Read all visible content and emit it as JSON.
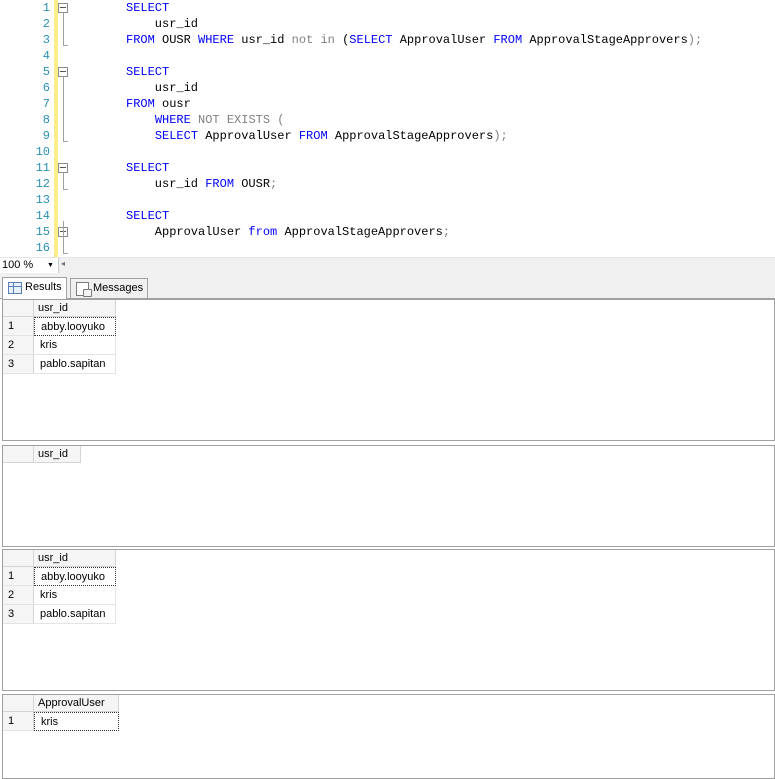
{
  "editor": {
    "lines": [
      {
        "n": "1",
        "tokens": [
          [
            "kw",
            "SELECT"
          ]
        ]
      },
      {
        "n": "2",
        "tokens": [
          [
            "tx",
            "    usr_id"
          ]
        ]
      },
      {
        "n": "3",
        "tokens": [
          [
            "kw",
            "FROM "
          ],
          [
            "tx",
            "OUSR "
          ],
          [
            "kw",
            "WHERE "
          ],
          [
            "tx",
            "usr_id "
          ],
          [
            "gr",
            "not in "
          ],
          [
            "tx",
            "("
          ],
          [
            "kw",
            "SELECT "
          ],
          [
            "tx",
            "ApprovalUser "
          ],
          [
            "kw",
            "FROM "
          ],
          [
            "tx",
            "ApprovalStageApprovers"
          ],
          [
            "gr",
            ");"
          ]
        ]
      },
      {
        "n": "4",
        "tokens": []
      },
      {
        "n": "5",
        "tokens": [
          [
            "kw",
            "SELECT"
          ]
        ]
      },
      {
        "n": "6",
        "tokens": [
          [
            "tx",
            "    usr_id"
          ]
        ]
      },
      {
        "n": "7",
        "tokens": [
          [
            "kw",
            "FROM "
          ],
          [
            "tx",
            "ousr"
          ]
        ]
      },
      {
        "n": "8",
        "tokens": [
          [
            "tx",
            "    "
          ],
          [
            "kw",
            "WHERE "
          ],
          [
            "gr",
            "NOT EXISTS ("
          ]
        ]
      },
      {
        "n": "9",
        "tokens": [
          [
            "tx",
            "    "
          ],
          [
            "kw",
            "SELECT "
          ],
          [
            "tx",
            "ApprovalUser "
          ],
          [
            "kw",
            "FROM "
          ],
          [
            "tx",
            "ApprovalStageApprovers"
          ],
          [
            "gr",
            ");"
          ]
        ]
      },
      {
        "n": "10",
        "tokens": []
      },
      {
        "n": "11",
        "tokens": [
          [
            "kw",
            "SELECT"
          ]
        ]
      },
      {
        "n": "12",
        "tokens": [
          [
            "tx",
            "    usr_id "
          ],
          [
            "kw",
            "FROM "
          ],
          [
            "tx",
            "OUSR"
          ],
          [
            "gr",
            ";"
          ]
        ]
      },
      {
        "n": "13",
        "tokens": []
      },
      {
        "n": "14",
        "tokens": [
          [
            "kw",
            "SELECT"
          ]
        ]
      },
      {
        "n": "15",
        "tokens": [
          [
            "tx",
            "    ApprovalUser "
          ],
          [
            "kw",
            "from "
          ],
          [
            "tx",
            "ApprovalStageApprovers"
          ],
          [
            "gr",
            ";"
          ]
        ]
      },
      {
        "n": "16",
        "tokens": []
      }
    ]
  },
  "zoom": {
    "value": "100 %"
  },
  "tabs": [
    {
      "label": "Results",
      "icon": "grid-icon"
    },
    {
      "label": "Messages",
      "icon": "messages-icon"
    }
  ],
  "results": [
    {
      "column": "usr_id",
      "rows": [
        "abby.looyuko",
        "kris",
        "pablo.sapitan"
      ]
    },
    {
      "column": "usr_id",
      "rows": []
    },
    {
      "column": "usr_id",
      "rows": [
        "abby.looyuko",
        "kris",
        "pablo.sapitan"
      ]
    },
    {
      "column": "ApprovalUser",
      "rows": [
        "kris"
      ]
    }
  ],
  "colors": {
    "keyword": "#0000ff",
    "gray": "#808080",
    "line_number": "#2b91af",
    "change_bar": "#ffef8a"
  }
}
